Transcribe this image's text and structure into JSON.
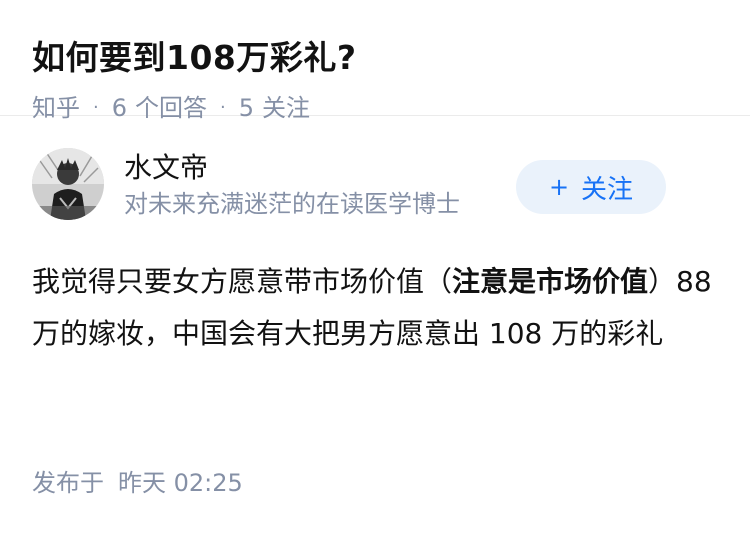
{
  "question": {
    "title": "如何要到108万彩礼?",
    "source": "知乎",
    "answer_count": "6",
    "answer_label": "个回答",
    "follower_count": "5",
    "follower_label": "关注"
  },
  "answer": {
    "author": {
      "name": "水文帝",
      "bio": "对未来充满迷茫的在读医学博士"
    },
    "follow_button": {
      "plus": "+",
      "label": "关注"
    },
    "content": {
      "part1": "我觉得只要女方愿意带市场价值（",
      "bold": "注意是市场价值",
      "part2": "）88 万的嫁妆，中国会有大把男方愿意出 108 万的彩礼"
    },
    "published_label": "发布于",
    "published_time": "昨天 02:25"
  },
  "colors": {
    "meta_gray": "#8590a6",
    "accent_blue": "#1772f6",
    "follow_bg": "#eaf2fb"
  }
}
